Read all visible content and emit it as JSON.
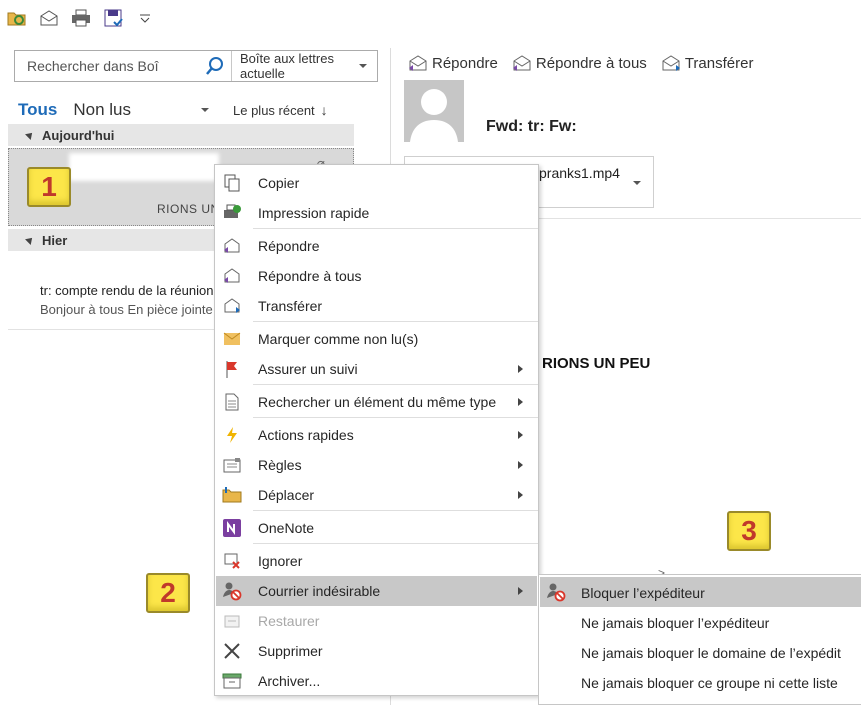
{
  "search": {
    "placeholder": "Rechercher dans Boî",
    "scope": "Boîte aux lettres actuelle"
  },
  "filters": {
    "all": "Tous",
    "unread": "Non lus",
    "sort": "Le plus récent",
    "sort_arrow": "↓"
  },
  "groups": {
    "today": "Aujourd'hui",
    "yesterday": "Hier"
  },
  "messages": {
    "selected_preview": "RIONS UN",
    "yesterday_subject": "tr: compte rendu de la réunion",
    "yesterday_snippet": "Bonjour à tous    En pièce jointe"
  },
  "reading": {
    "reply": "Répondre",
    "reply_all": "Répondre à tous",
    "forward": "Transférer",
    "subject": "Fwd: tr: Fw:",
    "attachment": "pranks1.mp4",
    "body": "RIONS UN PEU",
    "mark": ">"
  },
  "badges": {
    "one": "1",
    "two": "2",
    "three": "3"
  },
  "context_menu": {
    "copy": "Copier",
    "quick_print": "Impression rapide",
    "reply": "Répondre",
    "reply_all": "Répondre à tous",
    "forward": "Transférer",
    "mark_unread": "Marquer comme non lu(s)",
    "follow_up": "Assurer un suivi",
    "find_related": "Rechercher un élément du même type",
    "quick_steps": "Actions rapides",
    "rules": "Règles",
    "move": "Déplacer",
    "onenote": "OneNote",
    "ignore": "Ignorer",
    "junk": "Courrier indésirable",
    "restore": "Restaurer",
    "delete": "Supprimer",
    "archive": "Archiver..."
  },
  "junk_submenu": {
    "block_sender": "Bloquer l’expéditeur",
    "never_block_sender": "Ne jamais bloquer l’expéditeur",
    "never_block_domain": "Ne jamais bloquer le domaine de l’expédit",
    "never_block_group": "Ne jamais bloquer ce groupe ni cette liste"
  },
  "colors": {
    "accent": "#1e6bb8",
    "hover": "#c8c8c8",
    "badge_fill": "#fce649",
    "badge_text": "#c0392b"
  }
}
